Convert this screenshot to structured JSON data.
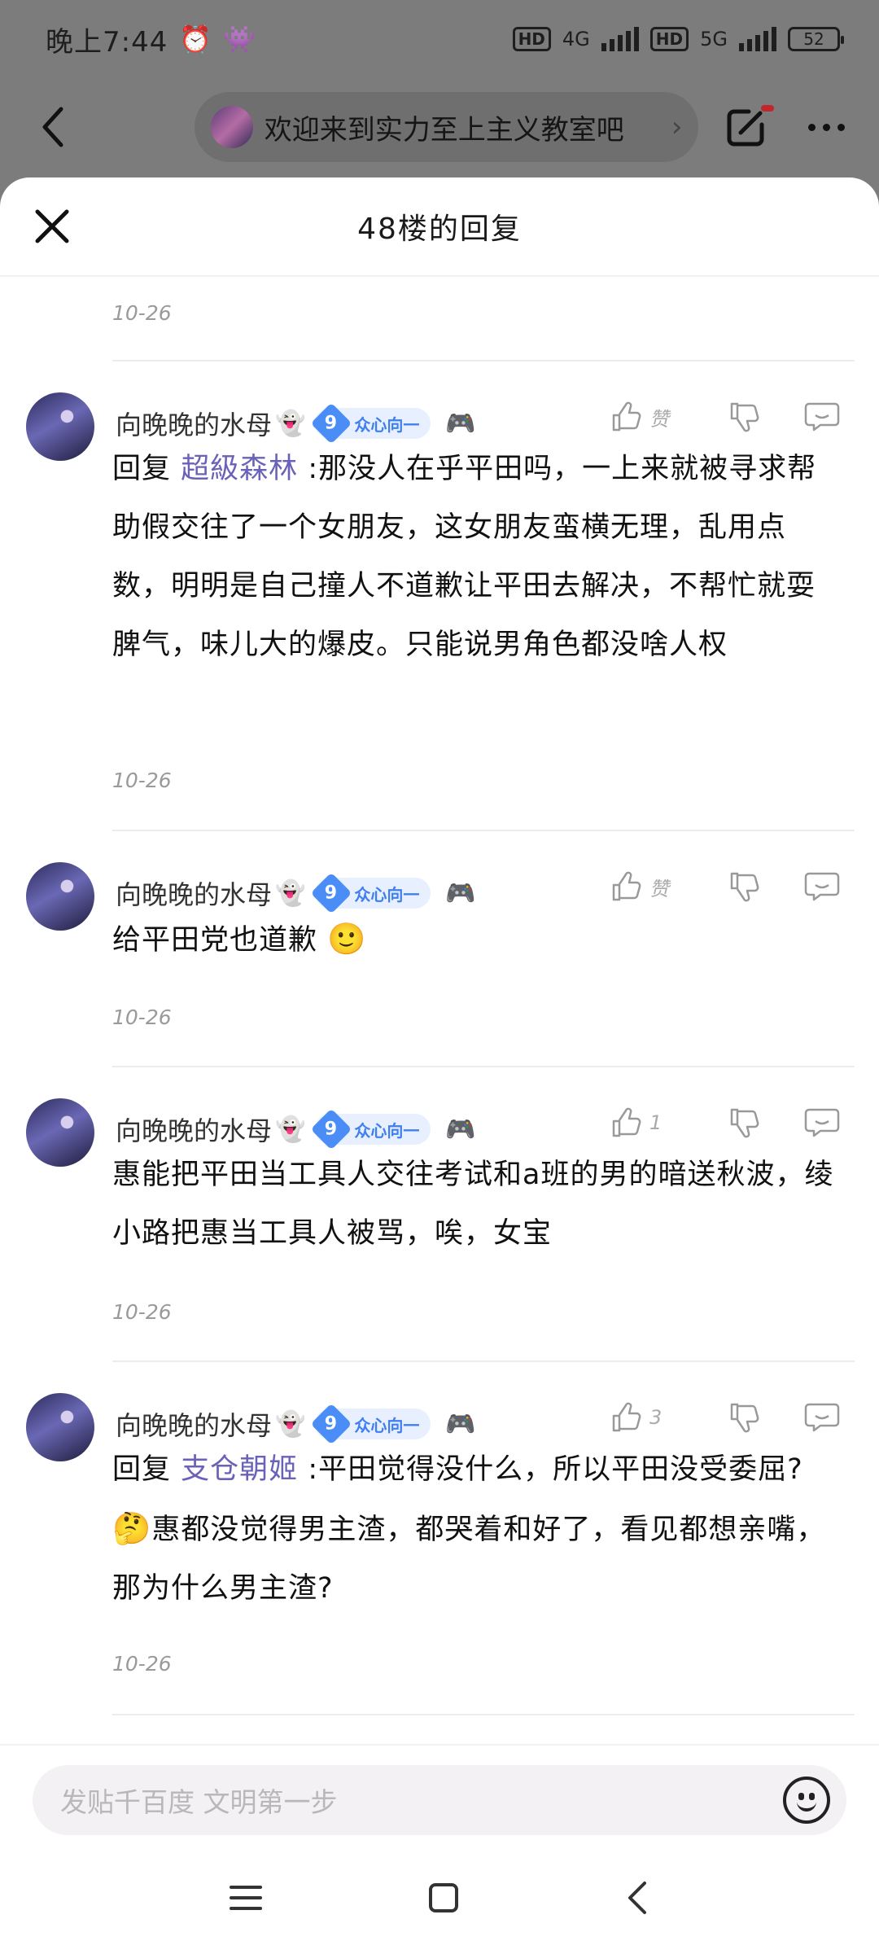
{
  "status_bar": {
    "time": "晚上7:44",
    "network": "4G",
    "network2": "5G",
    "battery": "52"
  },
  "top_nav": {
    "forum_name": "欢迎来到实力至上主义教室吧"
  },
  "sheet": {
    "title": "48楼的回复"
  },
  "top_date": "10-26",
  "posts": [
    {
      "username": "向晚晚的水母",
      "level": "9",
      "level_title": "众心向一",
      "like_label": "赞",
      "prefix": "回复",
      "mention": "超級森林",
      "text": ":那没人在乎平田吗，一上来就被寻求帮助假交往了一个女朋友，这女朋友蛮横无理，乱用点数，明明是自己撞人不道歉让平田去解决，不帮忙就耍脾气，味儿大的爆皮。只能说男角色都没啥人权",
      "date": "10-26"
    },
    {
      "username": "向晚晚的水母",
      "level": "9",
      "level_title": "众心向一",
      "like_label": "赞",
      "text": "给平田党也道歉",
      "emoji": "🙂",
      "date": "10-26"
    },
    {
      "username": "向晚晚的水母",
      "level": "9",
      "level_title": "众心向一",
      "like_label": "1",
      "text": "惠能把平田当工具人交往考试和a班的男的暗送秋波，绫小路把惠当工具人被骂，唉，女宝",
      "date": "10-26"
    },
    {
      "username": "向晚晚的水母",
      "level": "9",
      "level_title": "众心向一",
      "like_label": "3",
      "prefix": "回复",
      "mention": "支仓朝姬",
      "text_a": ":平田觉得没什么，所以平田没受委屈?",
      "emoji": "🤔",
      "text_b": "惠都没觉得男主渣，都哭着和好了，看见都想亲嘴，那为什么男主渣?",
      "date": "10-26"
    }
  ],
  "input": {
    "placeholder": "发贴千百度 文明第一步"
  },
  "icons": {
    "user_badge": "ghost-icon",
    "game": "gamepad-icon",
    "like": "thumbs-up-icon",
    "dislike": "thumbs-down-icon",
    "reply": "comment-icon"
  },
  "colors": {
    "mention": "#6a62b8",
    "level_badge": "#4b8df6",
    "accent_orange": "#f07e1d"
  }
}
